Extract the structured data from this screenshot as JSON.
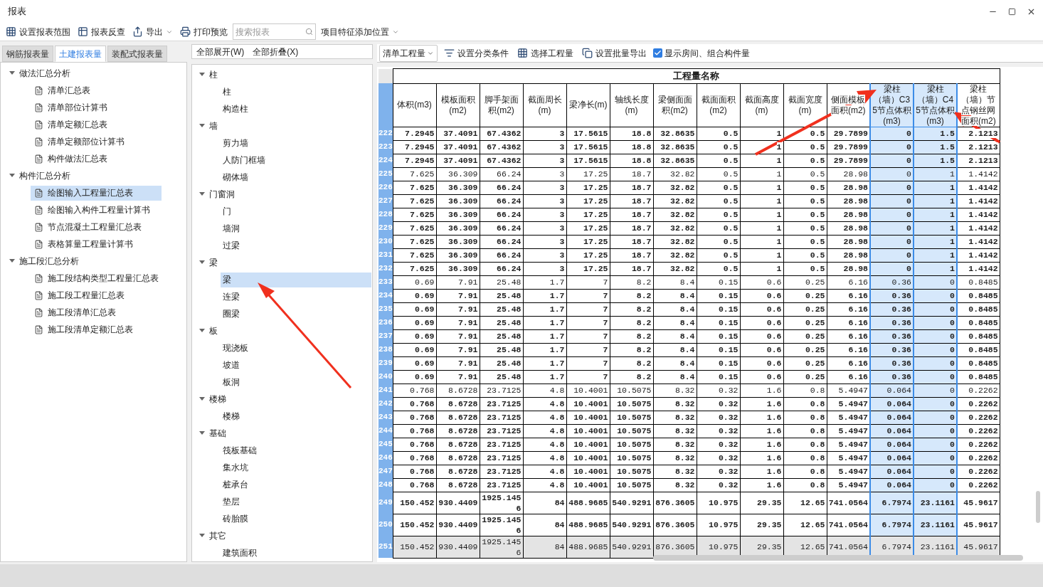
{
  "window": {
    "title": "报表"
  },
  "toolbar": [
    {
      "kind": "button",
      "label": "设置报表范围"
    },
    {
      "kind": "button",
      "label": "报表反查"
    },
    {
      "kind": "dropdown",
      "label": "导出"
    },
    {
      "kind": "button",
      "label": "打印预览"
    },
    {
      "kind": "search",
      "placeholder": "搜索报表"
    },
    {
      "kind": "dropdown",
      "label": "项目特征添加位置"
    }
  ],
  "report_tabs": [
    {
      "label": "钢筋报表量",
      "selected": false
    },
    {
      "label": "土建报表量",
      "selected": true
    },
    {
      "label": "装配式报表量",
      "selected": false
    }
  ],
  "report_tree": [
    {
      "label": "做法汇总分析",
      "expanded": true,
      "children": [
        {
          "label": "清单汇总表",
          "selected": false
        },
        {
          "label": "清单部位计算书",
          "selected": false
        },
        {
          "label": "清单定额汇总表",
          "selected": false
        },
        {
          "label": "清单定额部位计算书",
          "selected": false
        },
        {
          "label": "构件做法汇总表",
          "selected": false
        }
      ]
    },
    {
      "label": "构件汇总分析",
      "expanded": true,
      "children": [
        {
          "label": "绘图输入工程量汇总表",
          "selected": true
        },
        {
          "label": "绘图输入构件工程量计算书",
          "selected": false
        },
        {
          "label": "节点混凝土工程量汇总表",
          "selected": false
        },
        {
          "label": "表格算量工程量计算书",
          "selected": false
        }
      ]
    },
    {
      "label": "施工段汇总分析",
      "expanded": true,
      "children": [
        {
          "label": "施工段结构类型工程量汇总表",
          "selected": false
        },
        {
          "label": "施工段工程量汇总表",
          "selected": false
        },
        {
          "label": "施工段清单汇总表",
          "selected": false
        },
        {
          "label": "施工段清单定额汇总表",
          "selected": false
        }
      ]
    }
  ],
  "component_actions": [
    "全部展开(W)",
    "全部折叠(X)"
  ],
  "component_tree": [
    {
      "label": "柱",
      "expanded": true,
      "children": [
        {
          "label": "柱",
          "selected": false
        },
        {
          "label": "构造柱",
          "selected": false
        }
      ]
    },
    {
      "label": "墙",
      "expanded": true,
      "children": [
        {
          "label": "剪力墙",
          "selected": false
        },
        {
          "label": "人防门框墙",
          "selected": false
        },
        {
          "label": "砌体墙",
          "selected": false
        }
      ]
    },
    {
      "label": "门窗洞",
      "expanded": true,
      "children": [
        {
          "label": "门",
          "selected": false
        },
        {
          "label": "墙洞",
          "selected": false
        },
        {
          "label": "过梁",
          "selected": false
        }
      ]
    },
    {
      "label": "梁",
      "expanded": true,
      "children": [
        {
          "label": "梁",
          "selected": true
        },
        {
          "label": "连梁",
          "selected": false
        },
        {
          "label": "圈梁",
          "selected": false
        }
      ]
    },
    {
      "label": "板",
      "expanded": true,
      "children": [
        {
          "label": "现浇板",
          "selected": false
        },
        {
          "label": "坡道",
          "selected": false
        },
        {
          "label": "板洞",
          "selected": false
        }
      ]
    },
    {
      "label": "楼梯",
      "expanded": true,
      "children": [
        {
          "label": "楼梯",
          "selected": false
        }
      ]
    },
    {
      "label": "基础",
      "expanded": true,
      "children": [
        {
          "label": "筏板基础",
          "selected": false
        },
        {
          "label": "集水坑",
          "selected": false
        },
        {
          "label": "桩承台",
          "selected": false
        },
        {
          "label": "垫层",
          "selected": false
        },
        {
          "label": "砖胎膜",
          "selected": false
        }
      ]
    },
    {
      "label": "其它",
      "expanded": true,
      "children": [
        {
          "label": "建筑面积",
          "selected": false
        }
      ]
    }
  ],
  "table_toolbar": [
    {
      "kind": "select",
      "value": "清单工程量"
    },
    {
      "kind": "button",
      "label": "设置分类条件"
    },
    {
      "kind": "button",
      "label": "选择工程量"
    },
    {
      "kind": "button",
      "label": "设置批量导出"
    },
    {
      "kind": "checkbox",
      "label": "显示房间、组合构件量",
      "checked": true
    }
  ],
  "table": {
    "group_header": "工程量名称",
    "columns": [
      {
        "label": "体积(m3)",
        "selected": false
      },
      {
        "label": "模板面积(m2)",
        "selected": false
      },
      {
        "label": "脚手架面积(m2)",
        "selected": false
      },
      {
        "label": "截面周长(m)",
        "selected": false
      },
      {
        "label": "梁净长(m)",
        "selected": false
      },
      {
        "label": "轴线长度(m)",
        "selected": false
      },
      {
        "label": "梁侧面面积(m2)",
        "selected": false
      },
      {
        "label": "截面面积(m2)",
        "selected": false
      },
      {
        "label": "截面高度(m)",
        "selected": false
      },
      {
        "label": "截面宽度(m)",
        "selected": false
      },
      {
        "label": "侧面模板面积(m2)",
        "selected": false
      },
      {
        "label": "梁柱（墙）C35节点体积(m3)",
        "selected": true
      },
      {
        "label": "梁柱（墙）C45节点体积(m3)",
        "selected": true
      },
      {
        "label": "梁柱（墙）节点钢丝网面积(m2)",
        "selected": false
      }
    ],
    "rows": [
      {
        "number": "222",
        "bold": true,
        "shaded": false,
        "cells": [
          "7.2945",
          "37.4091",
          "67.4362",
          "3",
          "17.5615",
          "18.8",
          "32.8635",
          "0.5",
          "1",
          "0.5",
          "29.7899",
          "0",
          "1.5",
          "2.1213"
        ]
      },
      {
        "number": "223",
        "bold": true,
        "shaded": false,
        "cells": [
          "7.2945",
          "37.4091",
          "67.4362",
          "3",
          "17.5615",
          "18.8",
          "32.8635",
          "0.5",
          "1",
          "0.5",
          "29.7899",
          "0",
          "1.5",
          "2.1213"
        ]
      },
      {
        "number": "224",
        "bold": true,
        "shaded": false,
        "cells": [
          "7.2945",
          "37.4091",
          "67.4362",
          "3",
          "17.5615",
          "18.8",
          "32.8635",
          "0.5",
          "1",
          "0.5",
          "29.7899",
          "0",
          "1.5",
          "2.1213"
        ]
      },
      {
        "number": "225",
        "bold": false,
        "shaded": false,
        "cells": [
          "7.625",
          "36.309",
          "66.24",
          "3",
          "17.25",
          "18.7",
          "32.82",
          "0.5",
          "1",
          "0.5",
          "28.98",
          "0",
          "1",
          "1.4142"
        ]
      },
      {
        "number": "226",
        "bold": true,
        "shaded": false,
        "cells": [
          "7.625",
          "36.309",
          "66.24",
          "3",
          "17.25",
          "18.7",
          "32.82",
          "0.5",
          "1",
          "0.5",
          "28.98",
          "0",
          "1",
          "1.4142"
        ]
      },
      {
        "number": "227",
        "bold": true,
        "shaded": false,
        "cells": [
          "7.625",
          "36.309",
          "66.24",
          "3",
          "17.25",
          "18.7",
          "32.82",
          "0.5",
          "1",
          "0.5",
          "28.98",
          "0",
          "1",
          "1.4142"
        ]
      },
      {
        "number": "228",
        "bold": true,
        "shaded": false,
        "cells": [
          "7.625",
          "36.309",
          "66.24",
          "3",
          "17.25",
          "18.7",
          "32.82",
          "0.5",
          "1",
          "0.5",
          "28.98",
          "0",
          "1",
          "1.4142"
        ]
      },
      {
        "number": "229",
        "bold": true,
        "shaded": false,
        "cells": [
          "7.625",
          "36.309",
          "66.24",
          "3",
          "17.25",
          "18.7",
          "32.82",
          "0.5",
          "1",
          "0.5",
          "28.98",
          "0",
          "1",
          "1.4142"
        ]
      },
      {
        "number": "230",
        "bold": true,
        "shaded": false,
        "cells": [
          "7.625",
          "36.309",
          "66.24",
          "3",
          "17.25",
          "18.7",
          "32.82",
          "0.5",
          "1",
          "0.5",
          "28.98",
          "0",
          "1",
          "1.4142"
        ]
      },
      {
        "number": "231",
        "bold": true,
        "shaded": false,
        "cells": [
          "7.625",
          "36.309",
          "66.24",
          "3",
          "17.25",
          "18.7",
          "32.82",
          "0.5",
          "1",
          "0.5",
          "28.98",
          "0",
          "1",
          "1.4142"
        ]
      },
      {
        "number": "232",
        "bold": true,
        "shaded": false,
        "cells": [
          "7.625",
          "36.309",
          "66.24",
          "3",
          "17.25",
          "18.7",
          "32.82",
          "0.5",
          "1",
          "0.5",
          "28.98",
          "0",
          "1",
          "1.4142"
        ]
      },
      {
        "number": "233",
        "bold": false,
        "shaded": false,
        "cells": [
          "0.69",
          "7.91",
          "25.48",
          "1.7",
          "7",
          "8.2",
          "8.4",
          "0.15",
          "0.6",
          "0.25",
          "6.16",
          "0.36",
          "0",
          "0.8485"
        ]
      },
      {
        "number": "234",
        "bold": true,
        "shaded": false,
        "cells": [
          "0.69",
          "7.91",
          "25.48",
          "1.7",
          "7",
          "8.2",
          "8.4",
          "0.15",
          "0.6",
          "0.25",
          "6.16",
          "0.36",
          "0",
          "0.8485"
        ]
      },
      {
        "number": "235",
        "bold": true,
        "shaded": false,
        "cells": [
          "0.69",
          "7.91",
          "25.48",
          "1.7",
          "7",
          "8.2",
          "8.4",
          "0.15",
          "0.6",
          "0.25",
          "6.16",
          "0.36",
          "0",
          "0.8485"
        ]
      },
      {
        "number": "236",
        "bold": true,
        "shaded": false,
        "cells": [
          "0.69",
          "7.91",
          "25.48",
          "1.7",
          "7",
          "8.2",
          "8.4",
          "0.15",
          "0.6",
          "0.25",
          "6.16",
          "0.36",
          "0",
          "0.8485"
        ]
      },
      {
        "number": "237",
        "bold": true,
        "shaded": false,
        "cells": [
          "0.69",
          "7.91",
          "25.48",
          "1.7",
          "7",
          "8.2",
          "8.4",
          "0.15",
          "0.6",
          "0.25",
          "6.16",
          "0.36",
          "0",
          "0.8485"
        ]
      },
      {
        "number": "238",
        "bold": true,
        "shaded": false,
        "cells": [
          "0.69",
          "7.91",
          "25.48",
          "1.7",
          "7",
          "8.2",
          "8.4",
          "0.15",
          "0.6",
          "0.25",
          "6.16",
          "0.36",
          "0",
          "0.8485"
        ]
      },
      {
        "number": "239",
        "bold": true,
        "shaded": false,
        "cells": [
          "0.69",
          "7.91",
          "25.48",
          "1.7",
          "7",
          "8.2",
          "8.4",
          "0.15",
          "0.6",
          "0.25",
          "6.16",
          "0.36",
          "0",
          "0.8485"
        ]
      },
      {
        "number": "240",
        "bold": true,
        "shaded": false,
        "cells": [
          "0.69",
          "7.91",
          "25.48",
          "1.7",
          "7",
          "8.2",
          "8.4",
          "0.15",
          "0.6",
          "0.25",
          "6.16",
          "0.36",
          "0",
          "0.8485"
        ]
      },
      {
        "number": "241",
        "bold": false,
        "shaded": false,
        "cells": [
          "0.768",
          "8.6728",
          "23.7125",
          "4.8",
          "10.4001",
          "10.5075",
          "8.32",
          "0.32",
          "1.6",
          "0.8",
          "5.4947",
          "0.064",
          "0",
          "0.2262"
        ]
      },
      {
        "number": "242",
        "bold": true,
        "shaded": false,
        "cells": [
          "0.768",
          "8.6728",
          "23.7125",
          "4.8",
          "10.4001",
          "10.5075",
          "8.32",
          "0.32",
          "1.6",
          "0.8",
          "5.4947",
          "0.064",
          "0",
          "0.2262"
        ]
      },
      {
        "number": "243",
        "bold": true,
        "shaded": false,
        "cells": [
          "0.768",
          "8.6728",
          "23.7125",
          "4.8",
          "10.4001",
          "10.5075",
          "8.32",
          "0.32",
          "1.6",
          "0.8",
          "5.4947",
          "0.064",
          "0",
          "0.2262"
        ]
      },
      {
        "number": "244",
        "bold": true,
        "shaded": false,
        "cells": [
          "0.768",
          "8.6728",
          "23.7125",
          "4.8",
          "10.4001",
          "10.5075",
          "8.32",
          "0.32",
          "1.6",
          "0.8",
          "5.4947",
          "0.064",
          "0",
          "0.2262"
        ]
      },
      {
        "number": "245",
        "bold": true,
        "shaded": false,
        "cells": [
          "0.768",
          "8.6728",
          "23.7125",
          "4.8",
          "10.4001",
          "10.5075",
          "8.32",
          "0.32",
          "1.6",
          "0.8",
          "5.4947",
          "0.064",
          "0",
          "0.2262"
        ]
      },
      {
        "number": "246",
        "bold": true,
        "shaded": false,
        "cells": [
          "0.768",
          "8.6728",
          "23.7125",
          "4.8",
          "10.4001",
          "10.5075",
          "8.32",
          "0.32",
          "1.6",
          "0.8",
          "5.4947",
          "0.064",
          "0",
          "0.2262"
        ]
      },
      {
        "number": "247",
        "bold": true,
        "shaded": false,
        "cells": [
          "0.768",
          "8.6728",
          "23.7125",
          "4.8",
          "10.4001",
          "10.5075",
          "8.32",
          "0.32",
          "1.6",
          "0.8",
          "5.4947",
          "0.064",
          "0",
          "0.2262"
        ]
      },
      {
        "number": "248",
        "bold": true,
        "shaded": false,
        "cells": [
          "0.768",
          "8.6728",
          "23.7125",
          "4.8",
          "10.4001",
          "10.5075",
          "8.32",
          "0.32",
          "1.6",
          "0.8",
          "5.4947",
          "0.064",
          "0",
          "0.2262"
        ]
      },
      {
        "number": "249",
        "bold": true,
        "shaded": false,
        "cells": [
          "150.452",
          "930.4409",
          "1925.1456",
          "84",
          "488.9685",
          "540.9291",
          "876.3605",
          "10.975",
          "29.35",
          "12.65",
          "741.0564",
          "6.7974",
          "23.1161",
          "45.9617"
        ]
      },
      {
        "number": "250",
        "bold": true,
        "shaded": false,
        "cells": [
          "150.452",
          "930.4409",
          "1925.1456",
          "84",
          "488.9685",
          "540.9291",
          "876.3605",
          "10.975",
          "29.35",
          "12.65",
          "741.0564",
          "6.7974",
          "23.1161",
          "45.9617"
        ]
      },
      {
        "number": "251",
        "bold": false,
        "shaded": true,
        "cells": [
          "150.452",
          "930.4409",
          "1925.1456",
          "84",
          "488.9685",
          "540.9291",
          "876.3605",
          "10.975",
          "29.35",
          "12.65",
          "741.0564",
          "6.7974",
          "23.1161",
          "45.9617"
        ]
      }
    ]
  }
}
